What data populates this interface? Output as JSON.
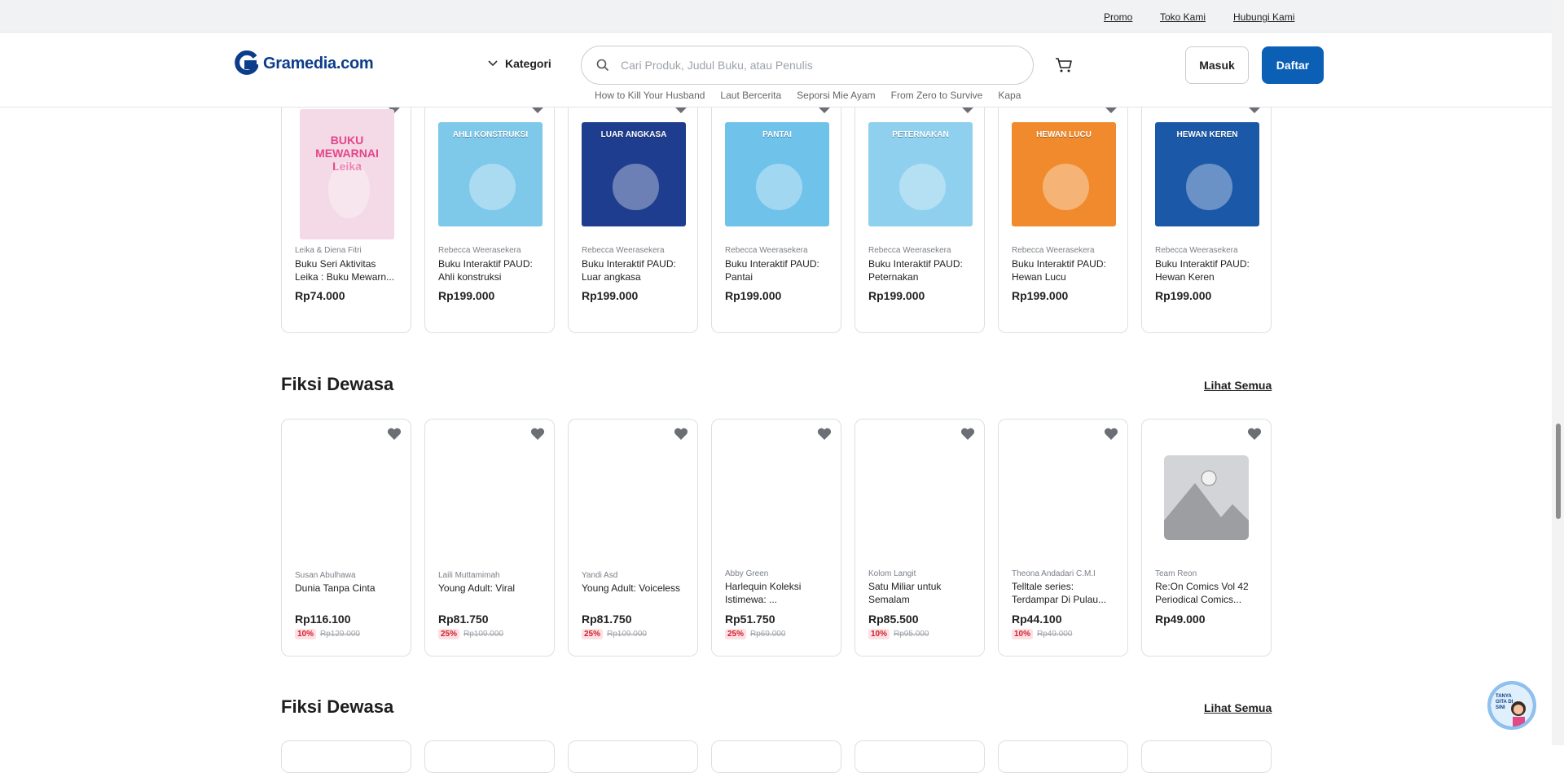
{
  "topbar": {
    "links": [
      "Promo",
      "Toko Kami",
      "Hubungi Kami"
    ]
  },
  "header": {
    "brand": "Gramedia.com",
    "kategori": "Kategori",
    "search_placeholder": "Cari Produk, Judul Buku, atau Penulis",
    "suggestions": [
      "How to Kill Your Husband",
      "Laut Bercerita",
      "Seporsi Mie Ayam",
      "From Zero to Survive",
      "Kapa"
    ],
    "login": "Masuk",
    "register": "Daftar"
  },
  "row1": [
    {
      "author": "Leika & Diena Fitri",
      "title": "Buku Seri Aktivitas Leika : Buku Mewarn...",
      "price": "Rp74.000",
      "cover_color": "#f4d9e6",
      "cover_text": "BUKU MEWARNAI Leika"
    },
    {
      "author": "Rebecca Weerasekera",
      "title": "Buku Interaktif PAUD: Ahli konstruksi",
      "price": "Rp199.000",
      "cover_color": "#7ec8ea",
      "cover_text": "AHLI KONSTRUKSI"
    },
    {
      "author": "Rebecca Weerasekera",
      "title": "Buku Interaktif PAUD: Luar angkasa",
      "price": "Rp199.000",
      "cover_color": "#1f3d8f",
      "cover_text": "LUAR ANGKASA"
    },
    {
      "author": "Rebecca Weerasekera",
      "title": "Buku Interaktif PAUD: Pantai",
      "price": "Rp199.000",
      "cover_color": "#6fc2e9",
      "cover_text": "PANTAI"
    },
    {
      "author": "Rebecca Weerasekera",
      "title": "Buku Interaktif PAUD: Peternakan",
      "price": "Rp199.000",
      "cover_color": "#8ed0ee",
      "cover_text": "PETERNAKAN"
    },
    {
      "author": "Rebecca Weerasekera",
      "title": "Buku Interaktif PAUD: Hewan Lucu",
      "price": "Rp199.000",
      "cover_color": "#f08a2c",
      "cover_text": "HEWAN LUCU"
    },
    {
      "author": "Rebecca Weerasekera",
      "title": "Buku Interaktif PAUD: Hewan Keren",
      "price": "Rp199.000",
      "cover_color": "#1c58a8",
      "cover_text": "HEWAN KEREN"
    }
  ],
  "section2": {
    "title": "Fiksi Dewasa",
    "see_all": "Lihat Semua"
  },
  "row2": [
    {
      "author": "Susan Abulhawa",
      "title": "Dunia Tanpa Cinta",
      "price": "Rp116.100",
      "pct": "10%",
      "old": "Rp129.000"
    },
    {
      "author": "Laili Muttamimah",
      "title": "Young Adult: Viral",
      "price": "Rp81.750",
      "pct": "25%",
      "old": "Rp109.000"
    },
    {
      "author": "Yandi Asd",
      "title": "Young Adult: Voiceless",
      "price": "Rp81.750",
      "pct": "25%",
      "old": "Rp109.000"
    },
    {
      "author": "Abby Green",
      "title": "Harlequin Koleksi Istimewa: ...",
      "price": "Rp51.750",
      "pct": "25%",
      "old": "Rp69.000"
    },
    {
      "author": "Kolom Langit",
      "title": "Satu Miliar untuk Semalam",
      "price": "Rp85.500",
      "pct": "10%",
      "old": "Rp95.000"
    },
    {
      "author": "Theona Andadari C.M.I",
      "title": "Telltale series: Terdampar Di Pulau...",
      "price": "Rp44.100",
      "pct": "10%",
      "old": "Rp49.000"
    },
    {
      "author": "Team Reon",
      "title": "Re:On Comics Vol 42 Periodical Comics...",
      "price": "Rp49.000",
      "pct": "",
      "old": ""
    }
  ],
  "section3": {
    "title": "Fiksi Dewasa",
    "see_all": "Lihat Semua"
  },
  "chat": {
    "label": "TANYA GITA DI SINI"
  }
}
